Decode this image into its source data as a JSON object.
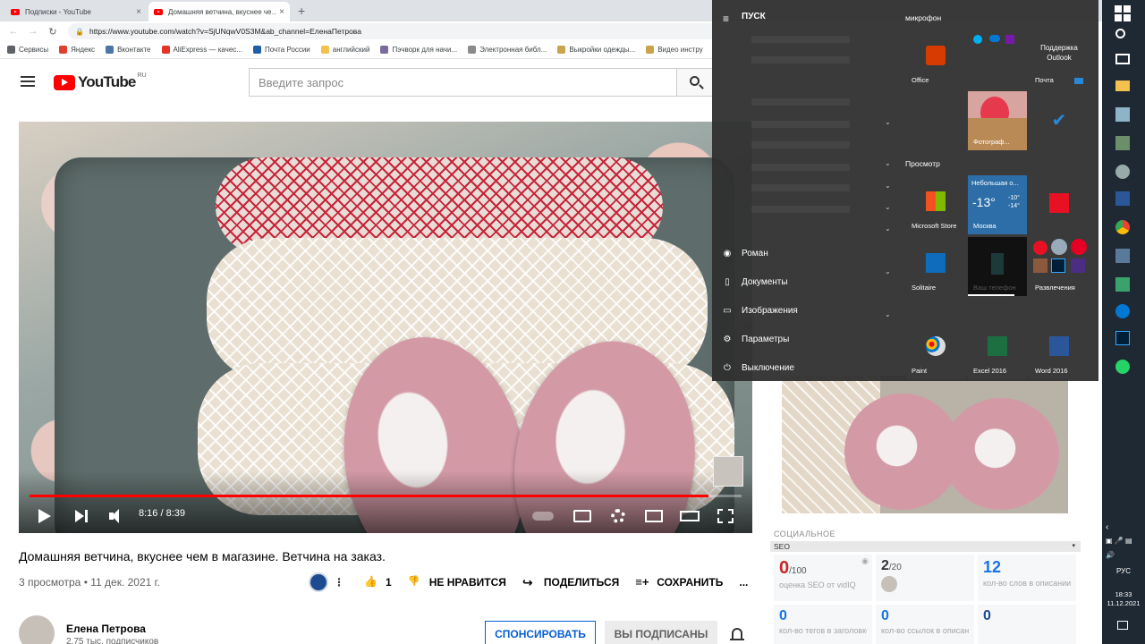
{
  "browser": {
    "tabs": [
      {
        "title": "Подписки - YouTube",
        "active": false
      },
      {
        "title": "Домашняя ветчина, вкуснее че…",
        "active": true
      }
    ],
    "new_tab": "+",
    "close": "×",
    "url": "https://www.youtube.com/watch?v=SjUNqwV0S3M&ab_channel=ЕленаПетрова",
    "bookmarks": [
      {
        "label": "Сервисы",
        "color": "#5f6368"
      },
      {
        "label": "Яндекс",
        "color": "#e0412f"
      },
      {
        "label": "Вконтакте",
        "color": "#4a76a8"
      },
      {
        "label": "AliExpress — качес...",
        "color": "#e43225"
      },
      {
        "label": "Почта России",
        "color": "#1f5fa8"
      },
      {
        "label": "английский",
        "color": "#f2c14e"
      },
      {
        "label": "Пэчворк для начи...",
        "color": "#7a6a9e"
      },
      {
        "label": "Электронная библ...",
        "color": "#8a8a8a"
      },
      {
        "label": "Выкройки одежды...",
        "color": "#caa34a"
      },
      {
        "label": "Видео инстру",
        "color": "#caa34a"
      }
    ]
  },
  "youtube": {
    "logo_text": "YouTube",
    "region": "RU",
    "search_placeholder": "Введите запрос"
  },
  "player": {
    "time": "8:16 / 8:39",
    "progress": 0.953
  },
  "video": {
    "title": "Домашняя ветчина, вкуснее чем в магазине. Ветчина на заказ.",
    "meta": "3 просмотра • 11 дек. 2021 г.",
    "likes": "1",
    "dislike_label": "НЕ НРАВИТСЯ",
    "share_label": "ПОДЕЛИТЬСЯ",
    "save_label": "СОХРАНИТЬ",
    "more": "..."
  },
  "channel": {
    "name": "Елена Петрова",
    "subscribers": "2,75 тыс. подписчиков",
    "sponsor_label": "СПОНСИРОВАТЬ",
    "subscribed_label": "ВЫ ПОДПИСАНЫ"
  },
  "vidiq": {
    "social_label": "СОЦИАЛЬНОЕ",
    "seo_label": "SEO",
    "caret": "▾",
    "score": "0",
    "score_max": "/100",
    "score_desc": "оценка SEO от vidIQ",
    "tags": "2",
    "tags_max": "/20",
    "words": "12",
    "words_desc": "кол-во слов в описании",
    "row2": [
      {
        "value": "0",
        "desc": "кол-во тегов в заголовке"
      },
      {
        "value": "0",
        "desc": "кол-во ссылок в описании"
      },
      {
        "value": "0",
        "desc": ""
      }
    ]
  },
  "start_menu": {
    "title": "ПУСК",
    "items": [
      {
        "label": "Роман",
        "icon": "user-icon"
      },
      {
        "label": "Документы",
        "icon": "document-icon"
      },
      {
        "label": "Изображения",
        "icon": "image-icon"
      },
      {
        "label": "Параметры",
        "icon": "gear-icon"
      },
      {
        "label": "Выключение",
        "icon": "power-icon"
      }
    ],
    "groups": {
      "mic": "микрофон",
      "view": "Просмотр"
    },
    "tiles": {
      "office": "Office",
      "outlook_support": "Поддержка Outlook",
      "mail": "Почта",
      "photos": "Фотограф...",
      "store": "Microsoft Store",
      "weather_title": "Небольшая о...",
      "weather_temp": "-13°",
      "weather_hi": "-10°",
      "weather_lo": "-14°",
      "weather_city": "Москва",
      "solitaire": "Solitaire",
      "phone": "Ваш телефон",
      "entertainment": "Развлечения",
      "paint": "Paint",
      "excel": "Excel 2016",
      "word": "Word 2016"
    }
  },
  "taskbar": {
    "lang": "РУС",
    "time": "18:33",
    "date": "11.12.2021"
  }
}
